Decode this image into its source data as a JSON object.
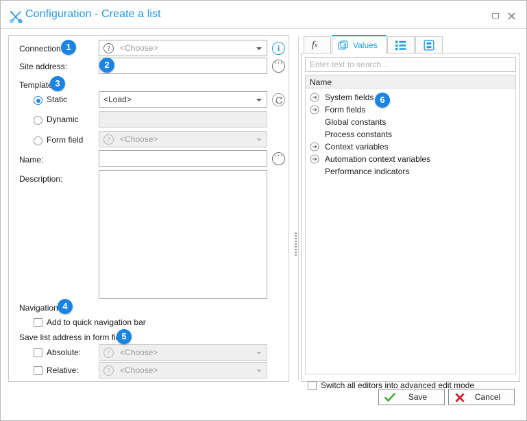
{
  "window": {
    "title": "Configuration - Create a list",
    "title_icon": "tools-icon",
    "maximize_label": "Maximize",
    "close_label": "Close"
  },
  "left_panel": {
    "connection": {
      "label": "Connection:",
      "value": "<Choose>",
      "badge": "1",
      "info_icon": "info-icon"
    },
    "site_address": {
      "label": "Site address:",
      "value": "",
      "badge": "2",
      "more_icon": "ellipsis-icon"
    },
    "template": {
      "label": "Template",
      "badge": "3",
      "static": {
        "label": "Static",
        "selected": true,
        "value": "<Load>",
        "refresh_icon": "refresh-icon"
      },
      "dynamic": {
        "label": "Dynamic",
        "selected": false,
        "value": ""
      },
      "form_field": {
        "label": "Form field",
        "selected": false,
        "value": "<Choose>"
      }
    },
    "name": {
      "label": "Name:",
      "value": "",
      "more_icon": "ellipsis-icon"
    },
    "description": {
      "label": "Description:",
      "value": ""
    },
    "navigation": {
      "label": "Navigation",
      "badge": "4",
      "quick_nav": {
        "label": "Add to quick navigation bar",
        "checked": false
      }
    },
    "save_list_address": {
      "label": "Save list address in form field",
      "badge": "5",
      "absolute": {
        "label": "Absolute:",
        "checked": false,
        "value": "<Choose>"
      },
      "relative": {
        "label": "Relative:",
        "checked": false,
        "value": "<Choose>"
      }
    }
  },
  "right_panel": {
    "tabs": [
      {
        "label": "",
        "icon": "function-fx-icon",
        "active": false
      },
      {
        "label": "Values",
        "icon": "values-a-icon",
        "active": true
      },
      {
        "label": "",
        "icon": "list-grid-icon",
        "active": false
      },
      {
        "label": "",
        "icon": "form-bracket-icon",
        "active": false
      }
    ],
    "search": {
      "placeholder": "Enter text to search...",
      "value": "",
      "icon": "search-input"
    },
    "grid_header": "Name",
    "badge": "6",
    "tree_items": [
      {
        "label": "System fields",
        "expandable": true
      },
      {
        "label": "Form fields",
        "expandable": true
      },
      {
        "label": "Global constants",
        "expandable": false
      },
      {
        "label": "Process constants",
        "expandable": false
      },
      {
        "label": "Context variables",
        "expandable": true
      },
      {
        "label": "Automation context variables",
        "expandable": true
      },
      {
        "label": "Performance indicators",
        "expandable": false
      }
    ],
    "advanced_mode": {
      "label": "Switch all editors into advanced edit mode",
      "checked": false
    }
  },
  "footer": {
    "save": {
      "label": "Save",
      "icon": "green-check-icon"
    },
    "cancel": {
      "label": "Cancel",
      "icon": "red-x-icon"
    }
  },
  "colors": {
    "accent": "#2196dd",
    "badge": "#1a84e2",
    "save": "#3faa34",
    "cancel": "#cc1f2c"
  }
}
